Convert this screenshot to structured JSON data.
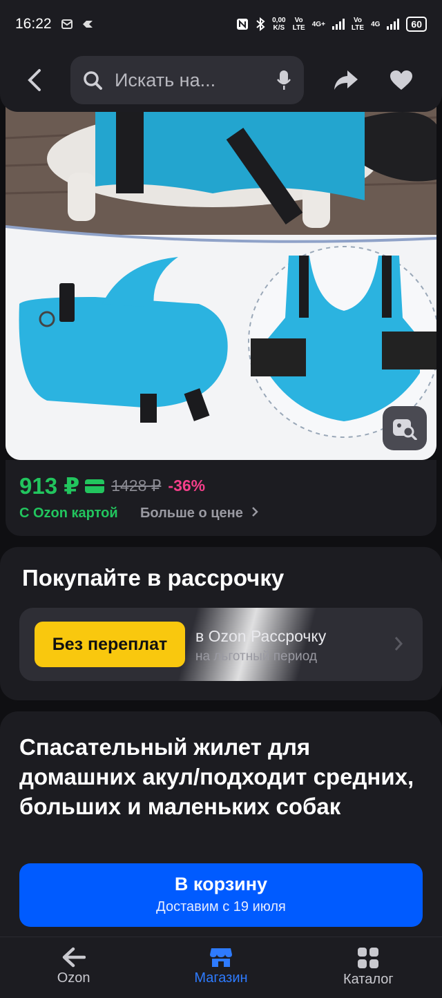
{
  "status_bar": {
    "time": "16:22",
    "net_speed_value": "0,00",
    "net_speed_unit": "K/S",
    "sim1_tech": "4G+",
    "sim2_tech": "4G",
    "volte_top": "Vo",
    "volte_bottom": "LTE",
    "battery": "60",
    "icons": [
      "nfc-icon",
      "bluetooth-icon",
      "signal-icon",
      "battery-icon"
    ]
  },
  "header": {
    "search_placeholder": "Искать на...",
    "icons": [
      "back-arrow-icon",
      "search-icon",
      "microphone-icon",
      "share-icon",
      "heart-icon"
    ]
  },
  "product": {
    "price": "913 ₽",
    "old_price": "1428 ₽",
    "discount": "-36%",
    "ozon_card_label": "С Ozon картой",
    "more_about_price": "Больше о цене",
    "title": "Спасательный жилет для домашних акул/подходит средних, больших и маленьких собак"
  },
  "installment": {
    "title": "Покупайте в рассрочку",
    "badge": "Без переплат",
    "line1": "в Ozon Рассрочку",
    "line2": "на льготный период"
  },
  "cart": {
    "label": "В корзину",
    "delivery": "Доставим с 19 июля"
  },
  "bottom_nav": [
    {
      "label": "Ozon",
      "icon": "arrow-left-icon",
      "active": false
    },
    {
      "label": "Магазин",
      "icon": "store-icon",
      "active": true
    },
    {
      "label": "Каталог",
      "icon": "grid-icon",
      "active": false
    }
  ],
  "colors": {
    "price_green": "#22c55e",
    "discount_pink": "#f43f8a",
    "primary_blue": "#005bff",
    "badge_yellow": "#f9c80e",
    "active_nav": "#2e7bff"
  }
}
